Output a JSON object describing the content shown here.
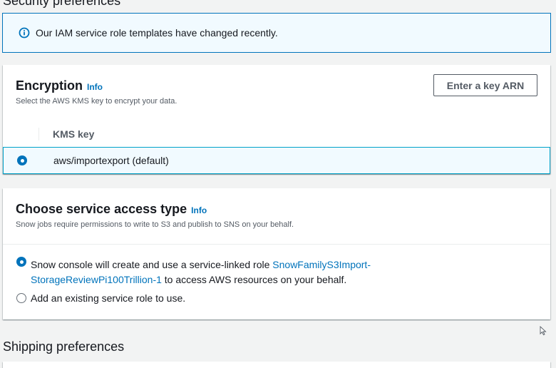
{
  "security_heading": "Security preferences",
  "flash": {
    "icon": "info-icon",
    "message": "Our IAM service role templates have changed recently."
  },
  "encryption": {
    "title": "Encryption",
    "info_label": "Info",
    "description": "Select the AWS KMS key to encrypt your data.",
    "key_arn_button": "Enter a key ARN",
    "table": {
      "column_header": "KMS key",
      "rows": [
        {
          "value": "aws/importexport (default)",
          "selected": true
        }
      ]
    }
  },
  "service_access": {
    "title": "Choose service access type",
    "info_label": "Info",
    "description": "Snow jobs require permissions to write to S3 and publish to SNS on your behalf.",
    "options": [
      {
        "selected": true,
        "text_before": "Snow console will create and use a service-linked role ",
        "link": "SnowFamilyS3Import-StorageReviewPi100Trillion-1",
        "text_after": " to access AWS resources on your behalf."
      },
      {
        "selected": false,
        "text": "Add an existing service role to use."
      }
    ]
  },
  "shipping_heading": "Shipping preferences",
  "colors": {
    "accent": "#0073bb",
    "info_bg": "#f1faff",
    "selected_border": "#00a1c9",
    "page_bg": "#f2f3f3"
  }
}
